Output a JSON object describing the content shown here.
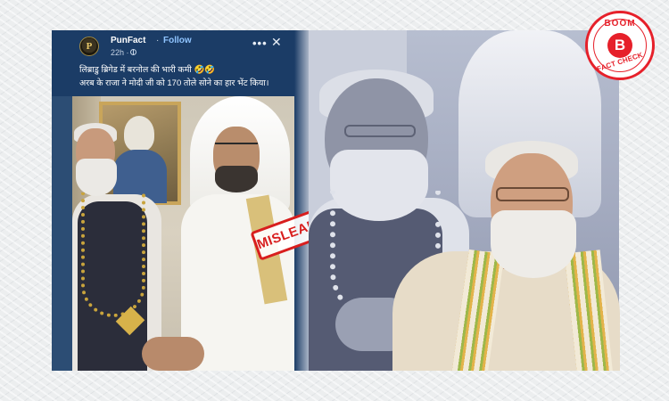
{
  "post": {
    "page_name": "PunFact",
    "avatar_letter": "P",
    "separator": "·",
    "follow_label": "Follow",
    "time": "22h ·",
    "more_label": "•••",
    "close_label": "✕",
    "caption_line1": "लिब्राडु ब्रिगेड में बरनोल की भारी कमी 🤣🤣",
    "caption_line2": "अरब के राजा ने मोदी जी को 170 तोले सोने का हार भेंट किया।"
  },
  "stamp": {
    "label": "MISLEADING"
  },
  "badge": {
    "top_text": "BOOM",
    "letter": "B",
    "bottom_text": "FACT CHECK"
  },
  "colors": {
    "post_header": "#1b3c66",
    "follow_link": "#8fc4ff",
    "stamp_red": "#d81e1e",
    "badge_red": "#e6202a"
  }
}
